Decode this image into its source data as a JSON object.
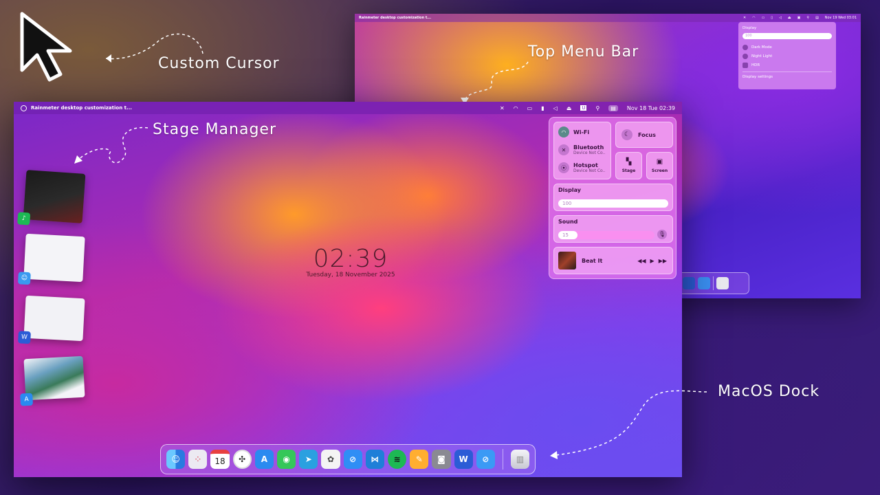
{
  "annotations": {
    "cursor": "Custom Cursor",
    "menubar": "Top Menu Bar",
    "stage": "Stage Manager",
    "dock": "MacOS Dock"
  },
  "back_window": {
    "menubar_title": "Rainmeter desktop customization t...",
    "datetime": "Nov 19 Wed 03:01",
    "display_panel": {
      "heading": "Display",
      "slider_value": "100",
      "options": [
        "Dark Mode",
        "Night Light",
        "HDR"
      ],
      "settings_link": "Display settings"
    }
  },
  "main_window": {
    "menubar_title": "Rainmeter desktop customization t...",
    "datetime": "Nov 18 Tue 02:39",
    "clock": {
      "time": "02:39",
      "date": "Tuesday, 18 November 2025"
    },
    "control_center": {
      "wifi": "Wi-Fi",
      "bluetooth": "Bluetooth",
      "bluetooth_status": "Device Not Co..",
      "hotspot": "Hotspot",
      "hotspot_status": "Device Not Co..",
      "focus": "Focus",
      "stage": "Stage",
      "screen": "Screen",
      "display_label": "Display",
      "display_value": "100",
      "sound_label": "Sound",
      "sound_value": "15",
      "sound_level": 0.2,
      "now_playing": "Beat It"
    },
    "dock": {
      "calendar_day": "18",
      "apps": [
        "finder",
        "launchpad",
        "calendar",
        "clock",
        "app-store",
        "messages",
        "telegram",
        "chatgpt",
        "safari",
        "vscode",
        "spotify",
        "pages",
        "screenshot",
        "word",
        "safari-2"
      ]
    }
  },
  "colors": {
    "accent": "#b02cb0",
    "clock_text": "#4a1a2a"
  }
}
